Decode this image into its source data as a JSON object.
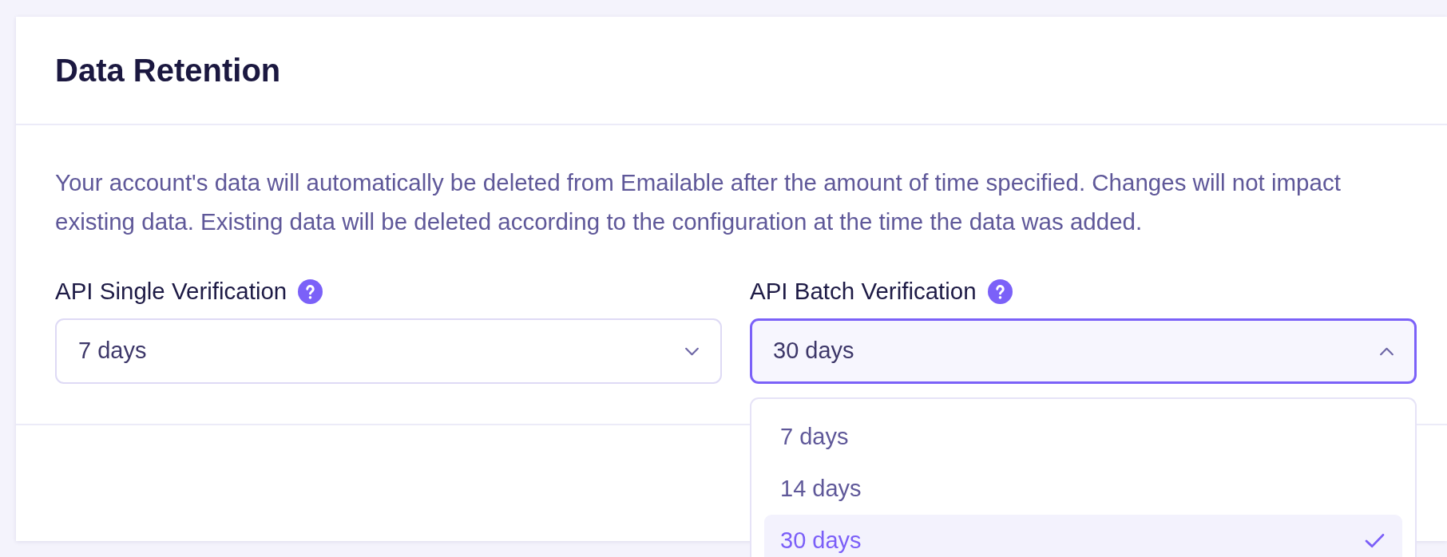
{
  "card": {
    "title": "Data Retention",
    "description": "Your account's data will automatically be deleted from Emailable after the amount of time specified. Changes will not impact existing data. Existing data will be deleted according to the configuration at the time the data was added.",
    "fields": [
      {
        "label": "API Single Verification",
        "value": "7 days",
        "expanded": false
      },
      {
        "label": "API Batch Verification",
        "value": "30 days",
        "expanded": true,
        "options": [
          {
            "label": "7 days",
            "selected": false
          },
          {
            "label": "14 days",
            "selected": false
          },
          {
            "label": "30 days",
            "selected": true
          }
        ]
      }
    ]
  }
}
